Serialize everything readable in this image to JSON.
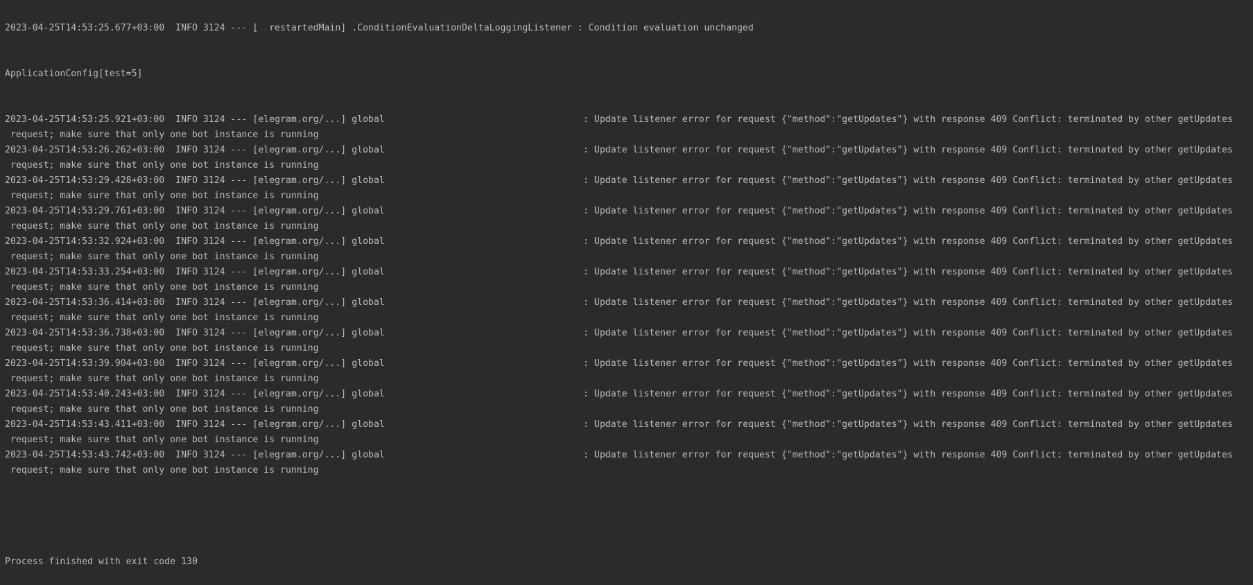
{
  "console": {
    "clipped_top_line": "2023-04-25T14:53:25.677+03:00  INFO 3124 --- [  restartedMain] .ConditionEvaluationDeltaLoggingListener : Condition evaluation unchanged",
    "config_line": "ApplicationConfig[test=5]",
    "log_entries": [
      {
        "prefix": "2023-04-25T14:53:25.921+03:00  INFO 3124 --- [elegram.org/...] global",
        "message": ": Update listener error for request {\"method\":\"getUpdates\"} with response 409 Conflict: terminated by other getUpdates",
        "continuation": " request; make sure that only one bot instance is running"
      },
      {
        "prefix": "2023-04-25T14:53:26.262+03:00  INFO 3124 --- [elegram.org/...] global",
        "message": ": Update listener error for request {\"method\":\"getUpdates\"} with response 409 Conflict: terminated by other getUpdates",
        "continuation": " request; make sure that only one bot instance is running"
      },
      {
        "prefix": "2023-04-25T14:53:29.428+03:00  INFO 3124 --- [elegram.org/...] global",
        "message": ": Update listener error for request {\"method\":\"getUpdates\"} with response 409 Conflict: terminated by other getUpdates",
        "continuation": " request; make sure that only one bot instance is running"
      },
      {
        "prefix": "2023-04-25T14:53:29.761+03:00  INFO 3124 --- [elegram.org/...] global",
        "message": ": Update listener error for request {\"method\":\"getUpdates\"} with response 409 Conflict: terminated by other getUpdates",
        "continuation": " request; make sure that only one bot instance is running"
      },
      {
        "prefix": "2023-04-25T14:53:32.924+03:00  INFO 3124 --- [elegram.org/...] global",
        "message": ": Update listener error for request {\"method\":\"getUpdates\"} with response 409 Conflict: terminated by other getUpdates",
        "continuation": " request; make sure that only one bot instance is running"
      },
      {
        "prefix": "2023-04-25T14:53:33.254+03:00  INFO 3124 --- [elegram.org/...] global",
        "message": ": Update listener error for request {\"method\":\"getUpdates\"} with response 409 Conflict: terminated by other getUpdates",
        "continuation": " request; make sure that only one bot instance is running"
      },
      {
        "prefix": "2023-04-25T14:53:36.414+03:00  INFO 3124 --- [elegram.org/...] global",
        "message": ": Update listener error for request {\"method\":\"getUpdates\"} with response 409 Conflict: terminated by other getUpdates",
        "continuation": " request; make sure that only one bot instance is running"
      },
      {
        "prefix": "2023-04-25T14:53:36.738+03:00  INFO 3124 --- [elegram.org/...] global",
        "message": ": Update listener error for request {\"method\":\"getUpdates\"} with response 409 Conflict: terminated by other getUpdates",
        "continuation": " request; make sure that only one bot instance is running"
      },
      {
        "prefix": "2023-04-25T14:53:39.904+03:00  INFO 3124 --- [elegram.org/...] global",
        "message": ": Update listener error for request {\"method\":\"getUpdates\"} with response 409 Conflict: terminated by other getUpdates",
        "continuation": " request; make sure that only one bot instance is running"
      },
      {
        "prefix": "2023-04-25T14:53:40.243+03:00  INFO 3124 --- [elegram.org/...] global",
        "message": ": Update listener error for request {\"method\":\"getUpdates\"} with response 409 Conflict: terminated by other getUpdates",
        "continuation": " request; make sure that only one bot instance is running"
      },
      {
        "prefix": "2023-04-25T14:53:43.411+03:00  INFO 3124 --- [elegram.org/...] global",
        "message": ": Update listener error for request {\"method\":\"getUpdates\"} with response 409 Conflict: terminated by other getUpdates",
        "continuation": " request; make sure that only one bot instance is running"
      },
      {
        "prefix": "2023-04-25T14:53:43.742+03:00  INFO 3124 --- [elegram.org/...] global",
        "message": ": Update listener error for request {\"method\":\"getUpdates\"} with response 409 Conflict: terminated by other getUpdates",
        "continuation": " request; make sure that only one bot instance is running"
      }
    ],
    "exit_line": "Process finished with exit code 130"
  }
}
